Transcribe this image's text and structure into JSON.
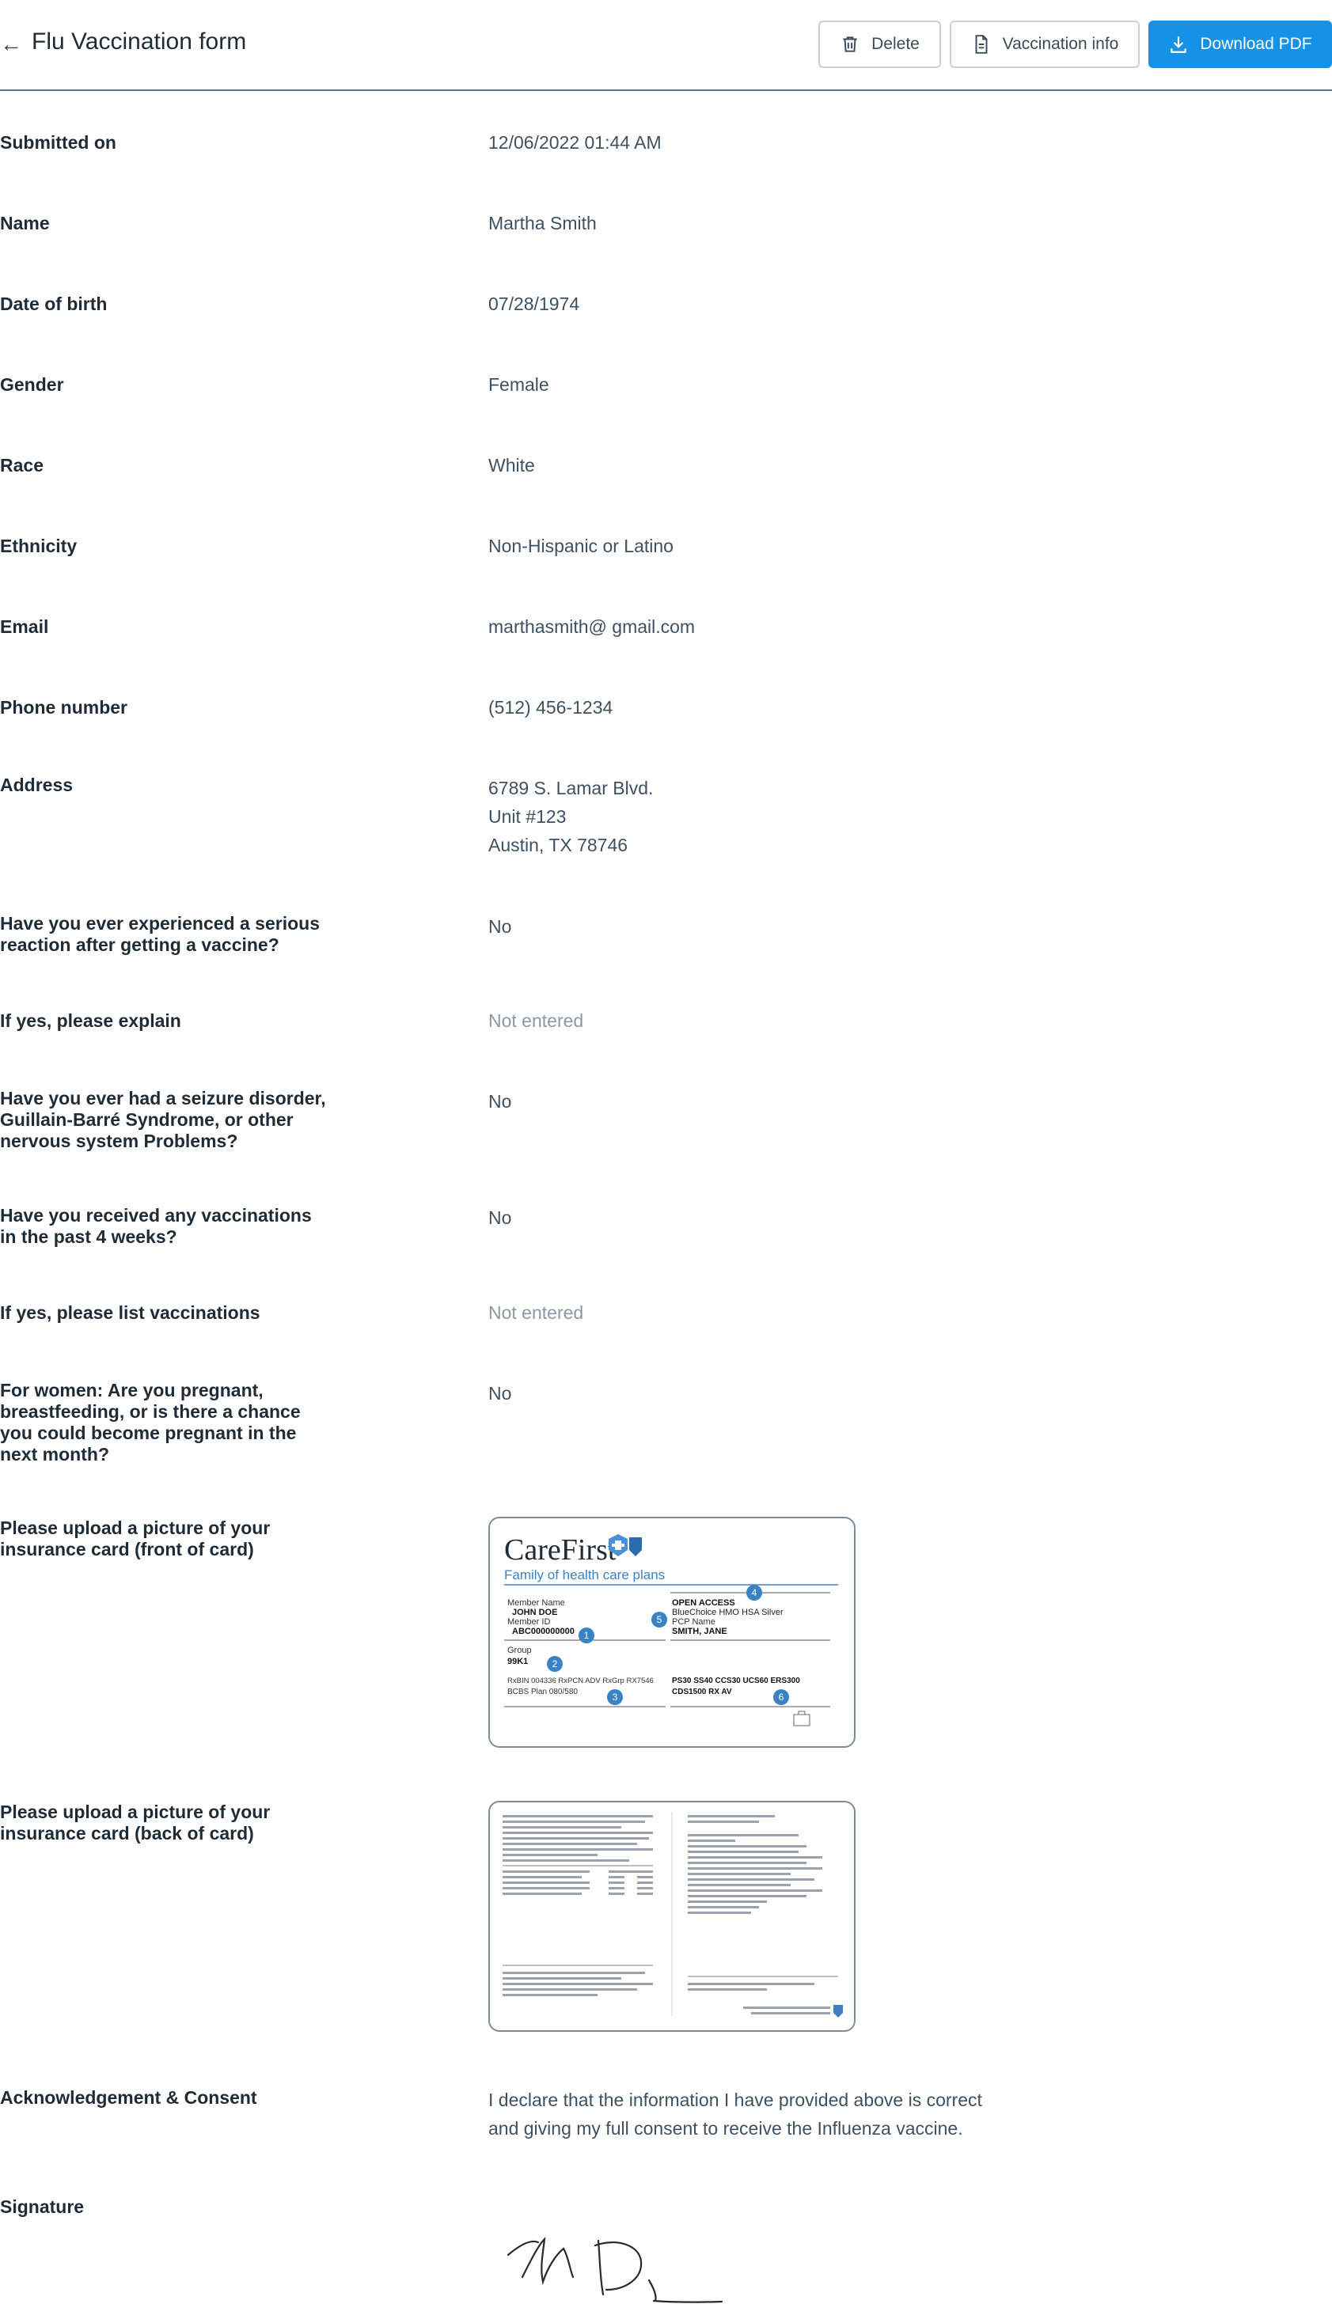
{
  "header": {
    "title": "Flu Vaccination form",
    "delete_label": "Delete",
    "info_label": "Vaccination info",
    "pdf_label": "Download PDF"
  },
  "fields": {
    "submitted_on": {
      "label": "Submitted on",
      "value": "12/06/2022 01:44 AM"
    },
    "name": {
      "label": "Name",
      "value": "Martha Smith"
    },
    "dob": {
      "label": "Date of birth",
      "value": "07/28/1974"
    },
    "gender": {
      "label": "Gender",
      "value": "Female"
    },
    "race": {
      "label": "Race",
      "value": "White"
    },
    "ethnicity": {
      "label": "Ethnicity",
      "value": "Non-Hispanic or Latino"
    },
    "email": {
      "label": "Email",
      "value": "marthasmith@ gmail.com"
    },
    "phone": {
      "label": "Phone number",
      "value": "(512) 456-1234"
    },
    "address": {
      "label": "Address",
      "line1": "6789 S. Lamar Blvd.",
      "line2": "Unit #123",
      "line3": "Austin, TX 78746"
    },
    "reaction": {
      "label": "Have you ever experienced a serious reaction after getting a vaccine?",
      "value": "No"
    },
    "reaction_explain": {
      "label": "If yes, please explain",
      "value": "Not entered"
    },
    "seizure": {
      "label": "Have you ever had a seizure disorder, Guillain-Barré Syndrome, or other nervous system Problems?",
      "value": "No"
    },
    "recent_vacc": {
      "label": "Have you received any vaccinations in the past 4 weeks?",
      "value": "No"
    },
    "recent_list": {
      "label": "If yes, please list vaccinations",
      "value": "Not entered"
    },
    "pregnant": {
      "label": "For women: Are you pregnant, breastfeeding, or is there a chance you could become pregnant in the next month?",
      "value": "No"
    },
    "card_front": {
      "label": "Please upload a picture of your insurance card (front of card)"
    },
    "card_back": {
      "label": "Please upload a picture of your insurance card (back of card)"
    },
    "consent": {
      "label": "Acknowledgement & Consent",
      "line1": "I declare that the information I have provided above is correct",
      "line2": "and giving my full consent to receive the Influenza vaccine."
    },
    "signature": {
      "label": "Signature"
    }
  },
  "card_front": {
    "brand": "CareFirst",
    "tagline": "Family of health care plans",
    "member_name_label": "Member Name",
    "member_name": "JOHN DOE",
    "member_id_label": "Member ID",
    "member_id": "ABC000000000",
    "group_label": "Group",
    "group": "99K1",
    "rx_line": "RxBIN 004336 RxPCN ADV RxGrp RX7546",
    "bcbs_line": "BCBS Plan 080/580",
    "plan_type": "OPEN ACCESS",
    "plan_name": "BlueChoice HMO HSA Silver",
    "pcp_label": "PCP Name",
    "pcp_name": "SMITH, JANE",
    "copays": "PS30 SS40 CCS30 UCS60 ERS300",
    "cds": "CDS1500 RX AV",
    "markers": [
      "1",
      "2",
      "3",
      "4",
      "5",
      "6"
    ]
  },
  "colors": {
    "accent": "#1591e6",
    "card_blue": "#3b82c4"
  }
}
